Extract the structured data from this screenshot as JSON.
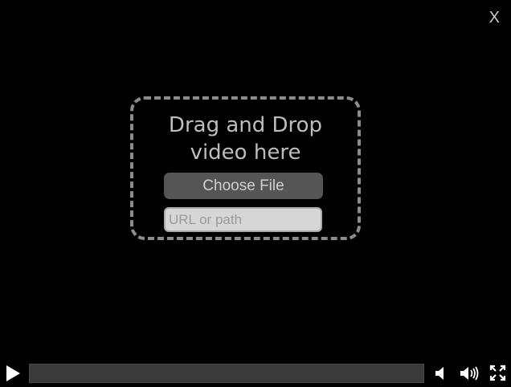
{
  "close": {
    "label": "X"
  },
  "dropzone": {
    "title": "Drag and Drop video here",
    "choose_file_label": "Choose File",
    "url_placeholder": "URL or path",
    "url_value": ""
  },
  "controls": {
    "play_icon": "play-icon",
    "mute_icon": "speaker-mute-icon",
    "volume_icon": "speaker-volume-icon",
    "fullscreen_icon": "fullscreen-icon",
    "progress": 0
  },
  "colors": {
    "background": "#000000",
    "dropzone_border": "#8c8c8c",
    "button_bg": "#555555",
    "progress_bg": "#3a3a3a",
    "icon": "#ffffff"
  }
}
